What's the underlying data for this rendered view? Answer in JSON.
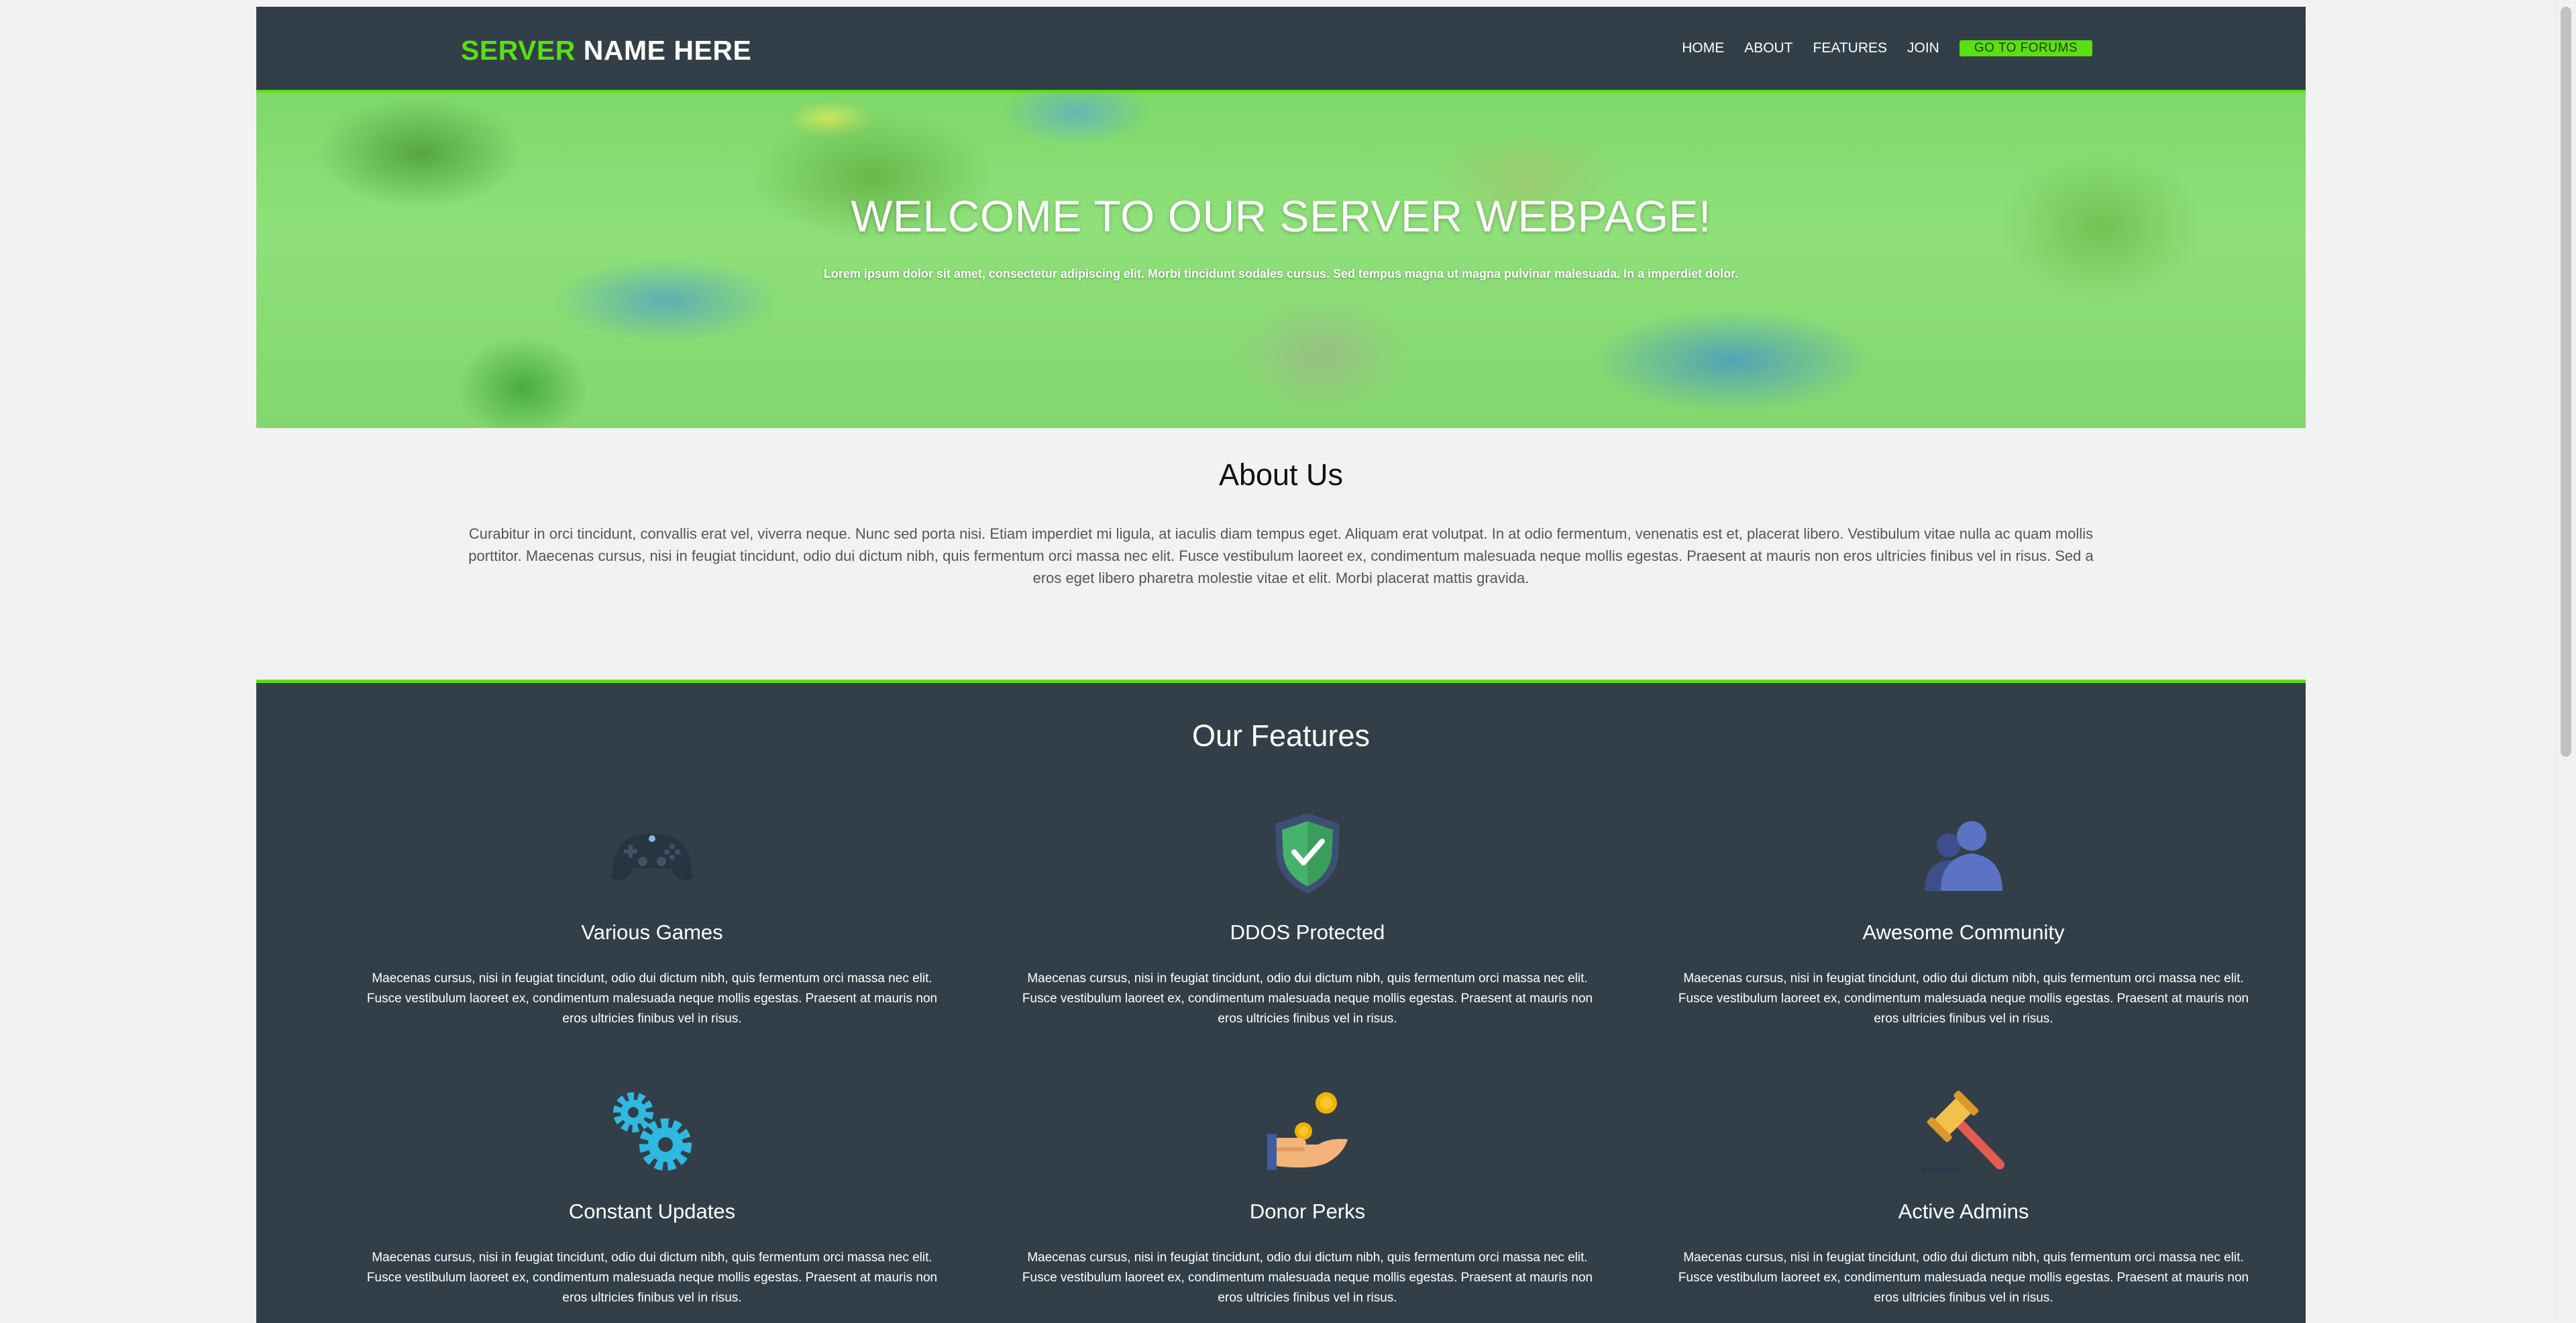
{
  "header": {
    "logo_accent": "SERVER",
    "logo_rest": "NAME HERE",
    "nav": [
      "HOME",
      "ABOUT",
      "FEATURES",
      "JOIN"
    ],
    "forums_button": "GO TO FORUMS"
  },
  "hero": {
    "title": "WELCOME TO OUR SERVER WEBPAGE!",
    "subtitle": "Lorem ipsum dolor sit amet, consectetur adipiscing elit. Morbi tincidunt sodales cursus. Sed tempus magna ut magna pulvinar malesuada. In a imperdiet dolor."
  },
  "about": {
    "title": "About Us",
    "text": "Curabitur in orci tincidunt, convallis erat vel, viverra neque. Nunc sed porta nisi. Etiam imperdiet mi ligula, at iaculis diam tempus eget. Aliquam erat volutpat. In at odio fermentum, venenatis est et, placerat libero. Vestibulum vitae nulla ac quam mollis porttitor. Maecenas cursus, nisi in feugiat tincidunt, odio dui dictum nibh, quis fermentum orci massa nec elit. Fusce vestibulum laoreet ex, condimentum malesuada neque mollis egestas. Praesent at mauris non eros ultricies finibus vel in risus. Sed a eros eget libero pharetra molestie vitae et elit. Morbi placerat mattis gravida."
  },
  "features": {
    "title": "Our Features",
    "items": [
      {
        "icon": "gamepad-icon",
        "title": "Various Games",
        "text": "Maecenas cursus, nisi in feugiat tincidunt, odio dui dictum nibh, quis fermentum orci massa nec elit. Fusce vestibulum laoreet ex, condimentum malesuada neque mollis egestas. Praesent at mauris non eros ultricies finibus vel in risus."
      },
      {
        "icon": "shield-check-icon",
        "title": "DDOS Protected",
        "text": "Maecenas cursus, nisi in feugiat tincidunt, odio dui dictum nibh, quis fermentum orci massa nec elit. Fusce vestibulum laoreet ex, condimentum malesuada neque mollis egestas. Praesent at mauris non eros ultricies finibus vel in risus."
      },
      {
        "icon": "users-icon",
        "title": "Awesome Community",
        "text": "Maecenas cursus, nisi in feugiat tincidunt, odio dui dictum nibh, quis fermentum orci massa nec elit. Fusce vestibulum laoreet ex, condimentum malesuada neque mollis egestas. Praesent at mauris non eros ultricies finibus vel in risus."
      },
      {
        "icon": "gears-icon",
        "title": "Constant Updates",
        "text": "Maecenas cursus, nisi in feugiat tincidunt, odio dui dictum nibh, quis fermentum orci massa nec elit. Fusce vestibulum laoreet ex, condimentum malesuada neque mollis egestas. Praesent at mauris non eros ultricies finibus vel in risus."
      },
      {
        "icon": "hand-coin-icon",
        "title": "Donor Perks",
        "text": "Maecenas cursus, nisi in feugiat tincidunt, odio dui dictum nibh, quis fermentum orci massa nec elit. Fusce vestibulum laoreet ex, condimentum malesuada neque mollis egestas. Praesent at mauris non eros ultricies finibus vel in risus."
      },
      {
        "icon": "gavel-icon",
        "title": "Active Admins",
        "text": "Maecenas cursus, nisi in feugiat tincidunt, odio dui dictum nibh, quis fermentum orci massa nec elit. Fusce vestibulum laoreet ex, condimentum malesuada neque mollis egestas. Praesent at mauris non eros ultricies finibus vel in risus."
      }
    ]
  },
  "colors": {
    "accent": "#58e011",
    "dark": "#333f48",
    "background": "#f2f2f2"
  }
}
